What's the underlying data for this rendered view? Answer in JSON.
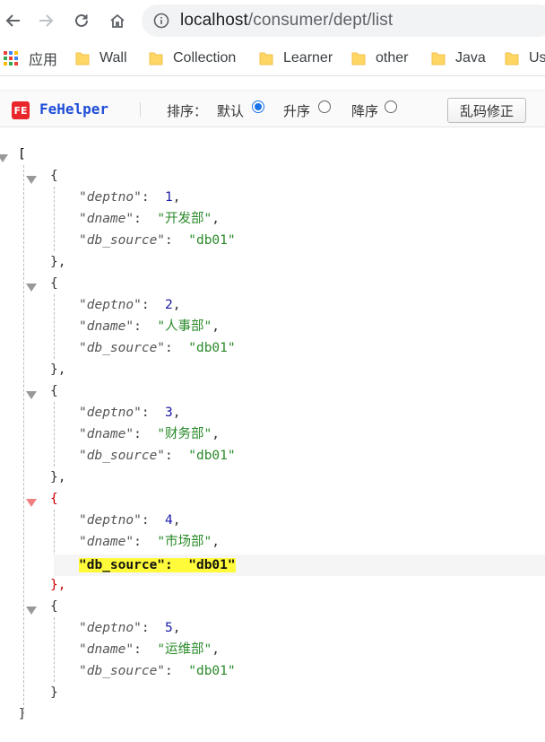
{
  "browser": {
    "url_host": "localhost",
    "url_path": "/consumer/dept/list",
    "nav_icons": [
      "back-arrow-icon",
      "forward-arrow-icon",
      "reload-icon",
      "home-icon"
    ]
  },
  "bookmarks": [
    {
      "label": "应用",
      "icon": "apps-grid-icon"
    },
    {
      "label": "Wall",
      "icon": "folder-icon"
    },
    {
      "label": "Collection",
      "icon": "folder-icon"
    },
    {
      "label": "Learner",
      "icon": "folder-icon"
    },
    {
      "label": "other",
      "icon": "folder-icon"
    },
    {
      "label": "Java",
      "icon": "folder-icon"
    },
    {
      "label": "Us",
      "icon": "folder-icon"
    }
  ],
  "fehelper": {
    "logo_text": "FE",
    "name": "FeHelper",
    "sort_label": "排序：",
    "options": [
      {
        "label": "默认",
        "checked": true
      },
      {
        "label": "升序",
        "checked": false
      },
      {
        "label": "降序",
        "checked": false
      }
    ],
    "fix_button": "乱码修正"
  },
  "json_viewer": {
    "open_bracket": "[",
    "close_bracket": "]",
    "keys": {
      "deptno": "\"deptno\"",
      "dname": "\"dname\"",
      "db_source": "\"db_source\""
    },
    "records": [
      {
        "deptno": "1",
        "dname": "\"开发部\"",
        "db_source": "\"db01\""
      },
      {
        "deptno": "2",
        "dname": "\"人事部\"",
        "db_source": "\"db01\""
      },
      {
        "deptno": "3",
        "dname": "\"财务部\"",
        "db_source": "\"db01\""
      },
      {
        "deptno": "4",
        "dname": "\"市场部\"",
        "db_source": "\"db01\""
      },
      {
        "deptno": "5",
        "dname": "\"运维部\"",
        "db_source": "\"db01\""
      }
    ],
    "highlighted_record": 3,
    "highlighted_field": "db_source"
  },
  "colors": {
    "number": "#1a1aa6",
    "string": "#2a8a2a",
    "highlight": "#fffb3a",
    "fehelper_blue": "#1e4ed8"
  }
}
